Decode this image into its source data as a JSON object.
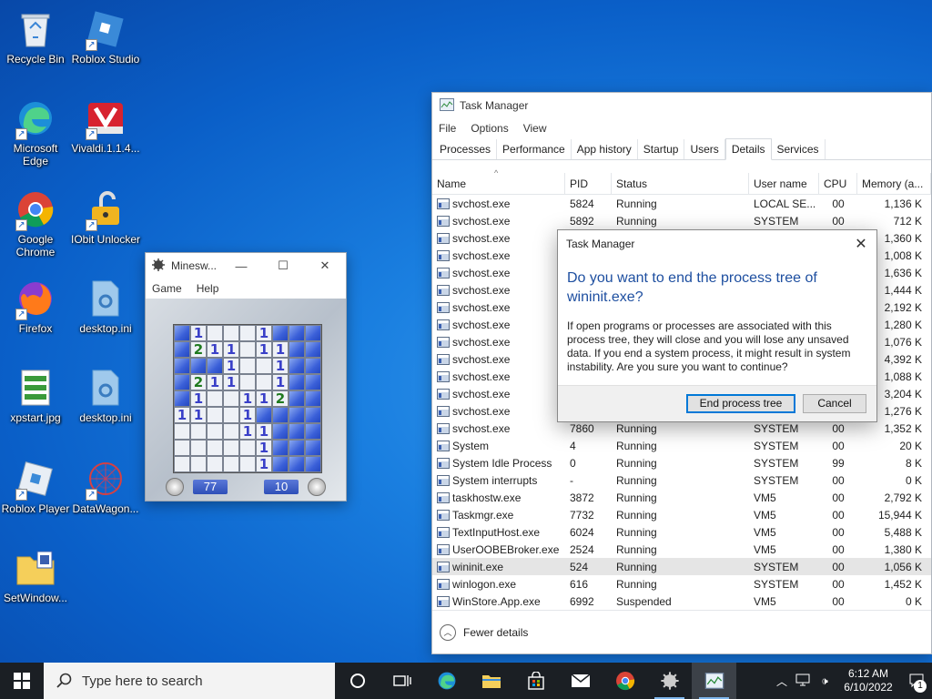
{
  "desktop": {
    "icons": [
      {
        "label": "Recycle Bin"
      },
      {
        "label": "Roblox Studio"
      },
      {
        "label": "Microsoft Edge"
      },
      {
        "label": "Vivaldi.1.1.4..."
      },
      {
        "label": "Google Chrome"
      },
      {
        "label": "IObit Unlocker"
      },
      {
        "label": "Firefox"
      },
      {
        "label": "desktop.ini"
      },
      {
        "label": "xpstart.jpg"
      },
      {
        "label": "desktop.ini"
      },
      {
        "label": "Roblox Player"
      },
      {
        "label": "DataWagon..."
      },
      {
        "label": "SetWindow..."
      }
    ]
  },
  "minesweeper": {
    "title": "Minesw...",
    "menu": [
      "Game",
      "Help"
    ],
    "time": "77",
    "mines": "10",
    "grid": [
      [
        "c",
        "1",
        "",
        "",
        "",
        "1",
        "c",
        "c",
        "c"
      ],
      [
        "c",
        "2",
        "1",
        "1",
        "",
        "1",
        "1",
        "c",
        "c"
      ],
      [
        "c",
        "c",
        "c",
        "1",
        "",
        "",
        "1",
        "c",
        "c"
      ],
      [
        "c",
        "2",
        "1",
        "1",
        "",
        "",
        "1",
        "c",
        "c"
      ],
      [
        "c",
        "1",
        "",
        "",
        "1",
        "1",
        "2",
        "c",
        "c"
      ],
      [
        "1",
        "1",
        "",
        "",
        "1",
        "c",
        "c",
        "c",
        "c"
      ],
      [
        "",
        "",
        "",
        "",
        "1",
        "1",
        "c",
        "c",
        "c"
      ],
      [
        "",
        "",
        "",
        "",
        "",
        "1",
        "c",
        "c",
        "c"
      ],
      [
        "",
        "",
        "",
        "",
        "",
        "1",
        "c",
        "c",
        "c"
      ]
    ]
  },
  "taskmanager": {
    "title": "Task Manager",
    "menu": [
      "File",
      "Options",
      "View"
    ],
    "tabs": [
      "Processes",
      "Performance",
      "App history",
      "Startup",
      "Users",
      "Details",
      "Services"
    ],
    "active_tab": "Details",
    "columns": [
      "Name",
      "PID",
      "Status",
      "User name",
      "CPU",
      "Memory (a..."
    ],
    "rows": [
      {
        "name": "svchost.exe",
        "pid": "5824",
        "status": "Running",
        "user": "LOCAL SE...",
        "cpu": "00",
        "mem": "1,136 K"
      },
      {
        "name": "svchost.exe",
        "pid": "5892",
        "status": "Running",
        "user": "SYSTEM",
        "cpu": "00",
        "mem": "712 K"
      },
      {
        "name": "svchost.exe",
        "pid": "",
        "status": "",
        "user": "",
        "cpu": "",
        "mem": "1,360 K"
      },
      {
        "name": "svchost.exe",
        "pid": "",
        "status": "",
        "user": "",
        "cpu": "",
        "mem": "1,008 K"
      },
      {
        "name": "svchost.exe",
        "pid": "",
        "status": "",
        "user": "",
        "cpu": "",
        "mem": "1,636 K"
      },
      {
        "name": "svchost.exe",
        "pid": "",
        "status": "",
        "user": "",
        "cpu": "",
        "mem": "1,444 K"
      },
      {
        "name": "svchost.exe",
        "pid": "",
        "status": "",
        "user": "",
        "cpu": "",
        "mem": "2,192 K"
      },
      {
        "name": "svchost.exe",
        "pid": "",
        "status": "",
        "user": "",
        "cpu": "",
        "mem": "1,280 K"
      },
      {
        "name": "svchost.exe",
        "pid": "",
        "status": "",
        "user": "",
        "cpu": "",
        "mem": "1,076 K"
      },
      {
        "name": "svchost.exe",
        "pid": "",
        "status": "",
        "user": "",
        "cpu": "",
        "mem": "4,392 K"
      },
      {
        "name": "svchost.exe",
        "pid": "",
        "status": "",
        "user": "",
        "cpu": "",
        "mem": "1,088 K"
      },
      {
        "name": "svchost.exe",
        "pid": "",
        "status": "",
        "user": "",
        "cpu": "",
        "mem": "3,204 K"
      },
      {
        "name": "svchost.exe",
        "pid": "",
        "status": "",
        "user": "",
        "cpu": "",
        "mem": "1,276 K"
      },
      {
        "name": "svchost.exe",
        "pid": "7860",
        "status": "Running",
        "user": "SYSTEM",
        "cpu": "00",
        "mem": "1,352 K"
      },
      {
        "name": "System",
        "pid": "4",
        "status": "Running",
        "user": "SYSTEM",
        "cpu": "00",
        "mem": "20 K"
      },
      {
        "name": "System Idle Process",
        "pid": "0",
        "status": "Running",
        "user": "SYSTEM",
        "cpu": "99",
        "mem": "8 K"
      },
      {
        "name": "System interrupts",
        "pid": "-",
        "status": "Running",
        "user": "SYSTEM",
        "cpu": "00",
        "mem": "0 K"
      },
      {
        "name": "taskhostw.exe",
        "pid": "3872",
        "status": "Running",
        "user": "VM5",
        "cpu": "00",
        "mem": "2,792 K"
      },
      {
        "name": "Taskmgr.exe",
        "pid": "7732",
        "status": "Running",
        "user": "VM5",
        "cpu": "00",
        "mem": "15,944 K"
      },
      {
        "name": "TextInputHost.exe",
        "pid": "6024",
        "status": "Running",
        "user": "VM5",
        "cpu": "00",
        "mem": "5,488 K"
      },
      {
        "name": "UserOOBEBroker.exe",
        "pid": "2524",
        "status": "Running",
        "user": "VM5",
        "cpu": "00",
        "mem": "1,380 K"
      },
      {
        "name": "wininit.exe",
        "pid": "524",
        "status": "Running",
        "user": "SYSTEM",
        "cpu": "00",
        "mem": "1,056 K",
        "selected": true
      },
      {
        "name": "winlogon.exe",
        "pid": "616",
        "status": "Running",
        "user": "SYSTEM",
        "cpu": "00",
        "mem": "1,452 K"
      },
      {
        "name": "WinStore.App.exe",
        "pid": "6992",
        "status": "Suspended",
        "user": "VM5",
        "cpu": "00",
        "mem": "0 K"
      }
    ],
    "fewer_details": "Fewer details"
  },
  "dialog": {
    "title": "Task Manager",
    "heading": "Do you want to end the process tree of wininit.exe?",
    "body": "If open programs or processes are associated with this process tree, they will close and you will lose any unsaved data. If you end a system process, it might result in system instability. Are you sure you want to continue?",
    "confirm": "End process tree",
    "cancel": "Cancel"
  },
  "taskbar": {
    "search_placeholder": "Type here to search",
    "time": "6:12 AM",
    "date": "6/10/2022",
    "notification_count": "1"
  },
  "colors": {
    "accent": "#0078d7",
    "dialog_heading": "#1e4fa0",
    "taskbar": "#1b1f24"
  }
}
